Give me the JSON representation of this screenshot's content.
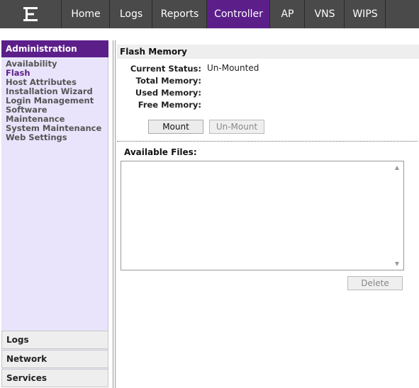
{
  "nav": {
    "tabs": [
      {
        "label": "Home"
      },
      {
        "label": "Logs"
      },
      {
        "label": "Reports"
      },
      {
        "label": "Controller"
      },
      {
        "label": "AP"
      },
      {
        "label": "VNS"
      },
      {
        "label": "WIPS"
      }
    ],
    "active_tab": "Controller",
    "active_color": "#5c1f8a"
  },
  "sidebar": {
    "header": "Administration",
    "links": [
      {
        "label": "Availability"
      },
      {
        "label": "Flash"
      },
      {
        "label": "Host Attributes"
      },
      {
        "label": "Installation Wizard"
      },
      {
        "label": "Login Management"
      },
      {
        "label": "Software Maintenance"
      },
      {
        "label": "System Maintenance"
      },
      {
        "label": "Web Settings"
      }
    ],
    "active_link": "Flash",
    "sections": [
      {
        "label": "Logs"
      },
      {
        "label": "Network"
      },
      {
        "label": "Services"
      }
    ]
  },
  "main": {
    "title": "Flash Memory",
    "fields": [
      {
        "label": "Current Status:",
        "value": "Un-Mounted"
      },
      {
        "label": "Total Memory:",
        "value": ""
      },
      {
        "label": "Used Memory:",
        "value": ""
      },
      {
        "label": "Free Memory:",
        "value": ""
      }
    ],
    "mount_label": "Mount",
    "unmount_label": "Un-Mount",
    "files_label": "Available Files:",
    "delete_label": "Delete"
  }
}
